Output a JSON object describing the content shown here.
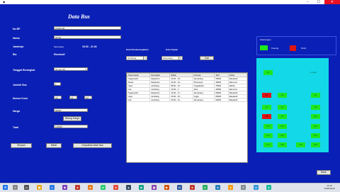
{
  "window": {
    "title": "",
    "min": "–",
    "max": "☐",
    "close": "✕"
  },
  "app": {
    "title": "Data Bus"
  },
  "fields": {
    "nobp": {
      "label": "No BP",
      "value": "07501740"
    },
    "nama": {
      "label": "Nama",
      "value": "0070k"
    },
    "jam": {
      "label": "Jamkerja",
      "value": "Semarang",
      "time": "15.00 - 21.00"
    },
    "bis": {
      "label": "Bis",
      "value": "Eksekutif"
    },
    "tanggal": {
      "label": "Tanggal Berangkat",
      "value": "31 Juni 16"
    },
    "jumlah": {
      "label": "Jumlah Bus",
      "value": "1"
    },
    "kursi": {
      "label": "Nomor Kursi",
      "values": [
        "A2",
        "A1",
        "A3"
      ]
    },
    "harga": {
      "label": "Harga",
      "value": "90000",
      "btn": "Hitung Harga"
    },
    "total": {
      "label": "Total",
      "value": "135000"
    }
  },
  "buttons": {
    "simpan": "Simpan",
    "batal": "Batal",
    "umpan": "Umpulkan Atas Nos",
    "back": "Back"
  },
  "kota": {
    "asal_label": "Kota Pemberangkatan",
    "tujuan_label": "Kota Tujuan",
    "asal": "Jombang",
    "tujuan": "Semarang",
    "cari": "Cari"
  },
  "table": {
    "headers": [
      "Nama kelas",
      "berangkat",
      "Waktu",
      "Jurusan",
      "Tarif",
      "Kelas"
    ],
    "rows": [
      [
        "Sugeng Ra",
        "Mojokerto",
        "10.00 - 13...",
        "Semarang",
        "55000",
        "Eksekutif"
      ],
      [
        "Restu",
        "Mojokerto",
        "10.00 - 13...",
        "Purworejo",
        "45000",
        "Ekonomi"
      ],
      [
        "Jaya",
        "Jombang",
        "08.00 - 12...",
        "Yogyakarta",
        "75000",
        "Ekstra"
      ],
      [
        "Ara",
        "Jombang",
        "13.00 - 1...",
        "Solo",
        "40000",
        "Ekonomi"
      ],
      [
        "Sugeng Ra",
        "Mojokerto",
        "13.00 - 17...",
        "Semarang",
        "80000",
        "Eksekutif"
      ],
      [
        "Jaya",
        "Jombang",
        "10.00 - 15...",
        "Jogja",
        "66000",
        "Eksekutif"
      ],
      [
        "Ara",
        "Jombang",
        "15.00 - 21...",
        "Semarang",
        "90000",
        "Eksekutif"
      ]
    ]
  },
  "legend": {
    "title": "Keterangan",
    "kosong": "Kosong",
    "terisi": "Terisi"
  },
  "seats": {
    "header": "A sopir",
    "list": [
      {
        "id": "A1",
        "status": "kosong"
      },
      {
        "id": "A2",
        "status": "terisi"
      },
      {
        "id": "A3",
        "status": "kosong"
      },
      {
        "id": "A4",
        "status": "kosong"
      },
      {
        "id": "A5",
        "status": "kosong"
      },
      {
        "id": "A6",
        "status": "kosong"
      },
      {
        "id": "A7",
        "status": "kosong"
      },
      {
        "id": "A8",
        "status": "terisi"
      },
      {
        "id": "A9",
        "status": "kosong"
      },
      {
        "id": "A10",
        "status": "kosong"
      },
      {
        "id": "A11",
        "status": "kosong"
      },
      {
        "id": "A12",
        "status": "kosong"
      },
      {
        "id": "A13",
        "status": "kosong"
      },
      {
        "id": "A14",
        "status": "kosong"
      },
      {
        "id": "A15",
        "status": "kosong"
      },
      {
        "id": "A16",
        "status": "kosong"
      },
      {
        "id": "A17",
        "status": "kosong"
      },
      {
        "id": "A18",
        "status": "kosong"
      },
      {
        "id": "A19",
        "status": "kosong"
      },
      {
        "id": "A20",
        "status": "kosong"
      }
    ]
  },
  "taskbar": {
    "time": "12:16",
    "date": "13/06/2018",
    "colors": {
      "kosong": "#1ee81e",
      "terisi": "#e01414",
      "panel": "#13d8e8",
      "bg": "#0a1fb5"
    }
  }
}
